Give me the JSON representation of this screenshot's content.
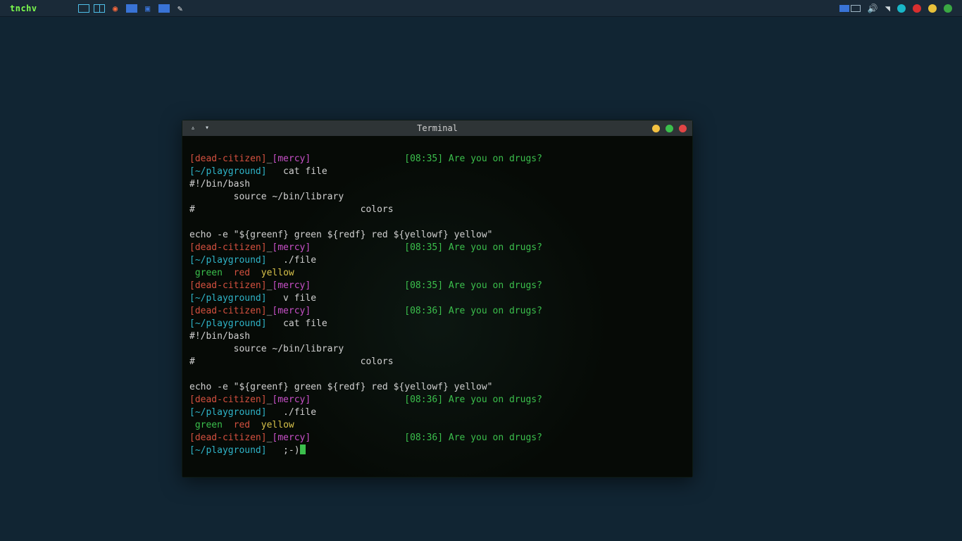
{
  "panel": {
    "menu_label": "tnchv"
  },
  "window": {
    "title": "Terminal"
  },
  "prompt": {
    "user": "[dead-citizen]",
    "sep": "_",
    "host": "[mercy]",
    "path": "[~/playground]",
    "msg": "Are you on drugs?"
  },
  "times": {
    "t1": "[08:35]",
    "t2": "[08:36]"
  },
  "cmd": {
    "cat": "   cat file",
    "run": "   ./file",
    "v": "   v file",
    "smile": "   ;-)"
  },
  "file": {
    "l1": "#!/bin/bash",
    "l2": "        source ~/bin/library",
    "l3": "#                              colors",
    "l4": "",
    "l5": "echo -e \"${greenf} green ${redf} red ${yellowf} yellow\""
  },
  "out": {
    "green": " green ",
    "red": " red ",
    "yellow": " yellow"
  }
}
